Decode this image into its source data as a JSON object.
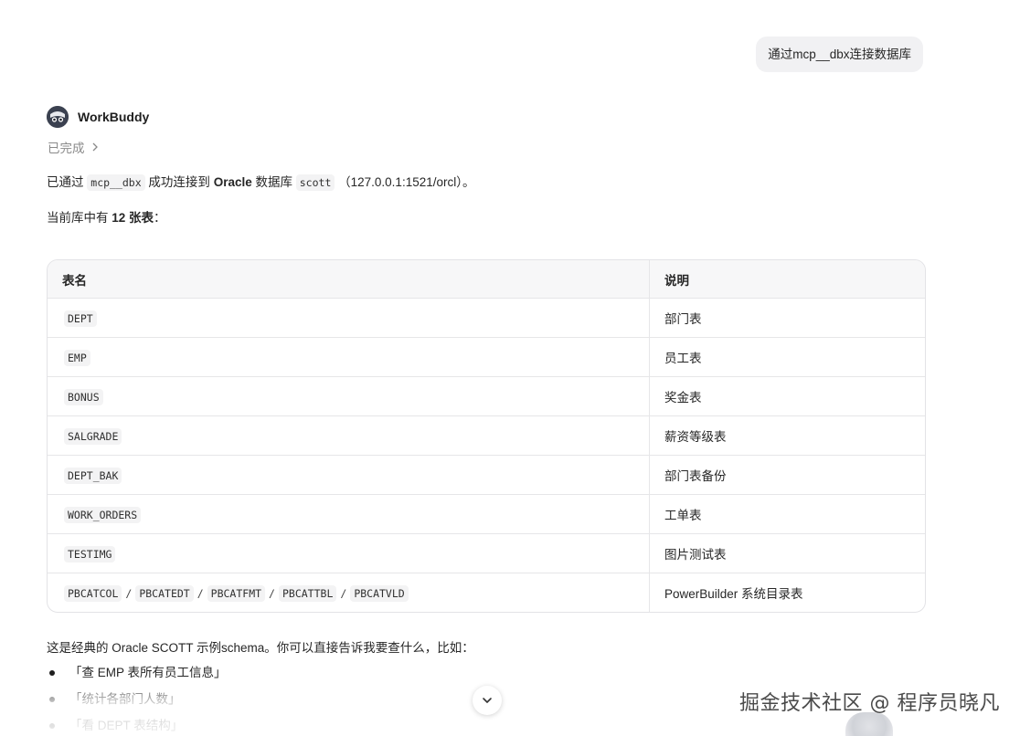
{
  "user_message": "通过mcp__dbx连接数据库",
  "agent": {
    "name": "WorkBuddy",
    "avatar_icon": "raccoon-avatar-icon",
    "status": "已完成"
  },
  "connection": {
    "prefix": "已通过",
    "tool": "mcp__dbx",
    "middle": "成功连接到",
    "db_name": "Oracle",
    "db_suffix": "数据库",
    "schema": "scott",
    "address": "（127.0.0.1:1521/orcl）。"
  },
  "summary": {
    "prefix": "当前库中有",
    "count": "12 张表",
    "suffix": "："
  },
  "table": {
    "headers": [
      "表名",
      "说明"
    ],
    "rows": [
      {
        "name": "DEPT",
        "desc": "部门表"
      },
      {
        "name": "EMP",
        "desc": "员工表"
      },
      {
        "name": "BONUS",
        "desc": "奖金表"
      },
      {
        "name": "SALGRADE",
        "desc": "薪资等级表"
      },
      {
        "name": "DEPT_BAK",
        "desc": "部门表备份"
      },
      {
        "name": "WORK_ORDERS",
        "desc": "工单表"
      },
      {
        "name": "TESTIMG",
        "desc": "图片测试表"
      }
    ],
    "last_row": {
      "names": [
        "PBCATCOL",
        "PBCATEDT",
        "PBCATFMT",
        "PBCATTBL",
        "PBCATVLD"
      ],
      "separator": "/",
      "desc": "PowerBuilder 系统目录表"
    }
  },
  "suggestions": {
    "intro": "这是经典的 Oracle SCOTT 示例schema。你可以直接告诉我要查什么，比如：",
    "items": [
      "「查 EMP 表所有员工信息」",
      "「统计各部门人数」",
      "「看 DEPT 表结构」"
    ]
  },
  "watermark": "掘金技术社区 @ 程序员晓凡"
}
